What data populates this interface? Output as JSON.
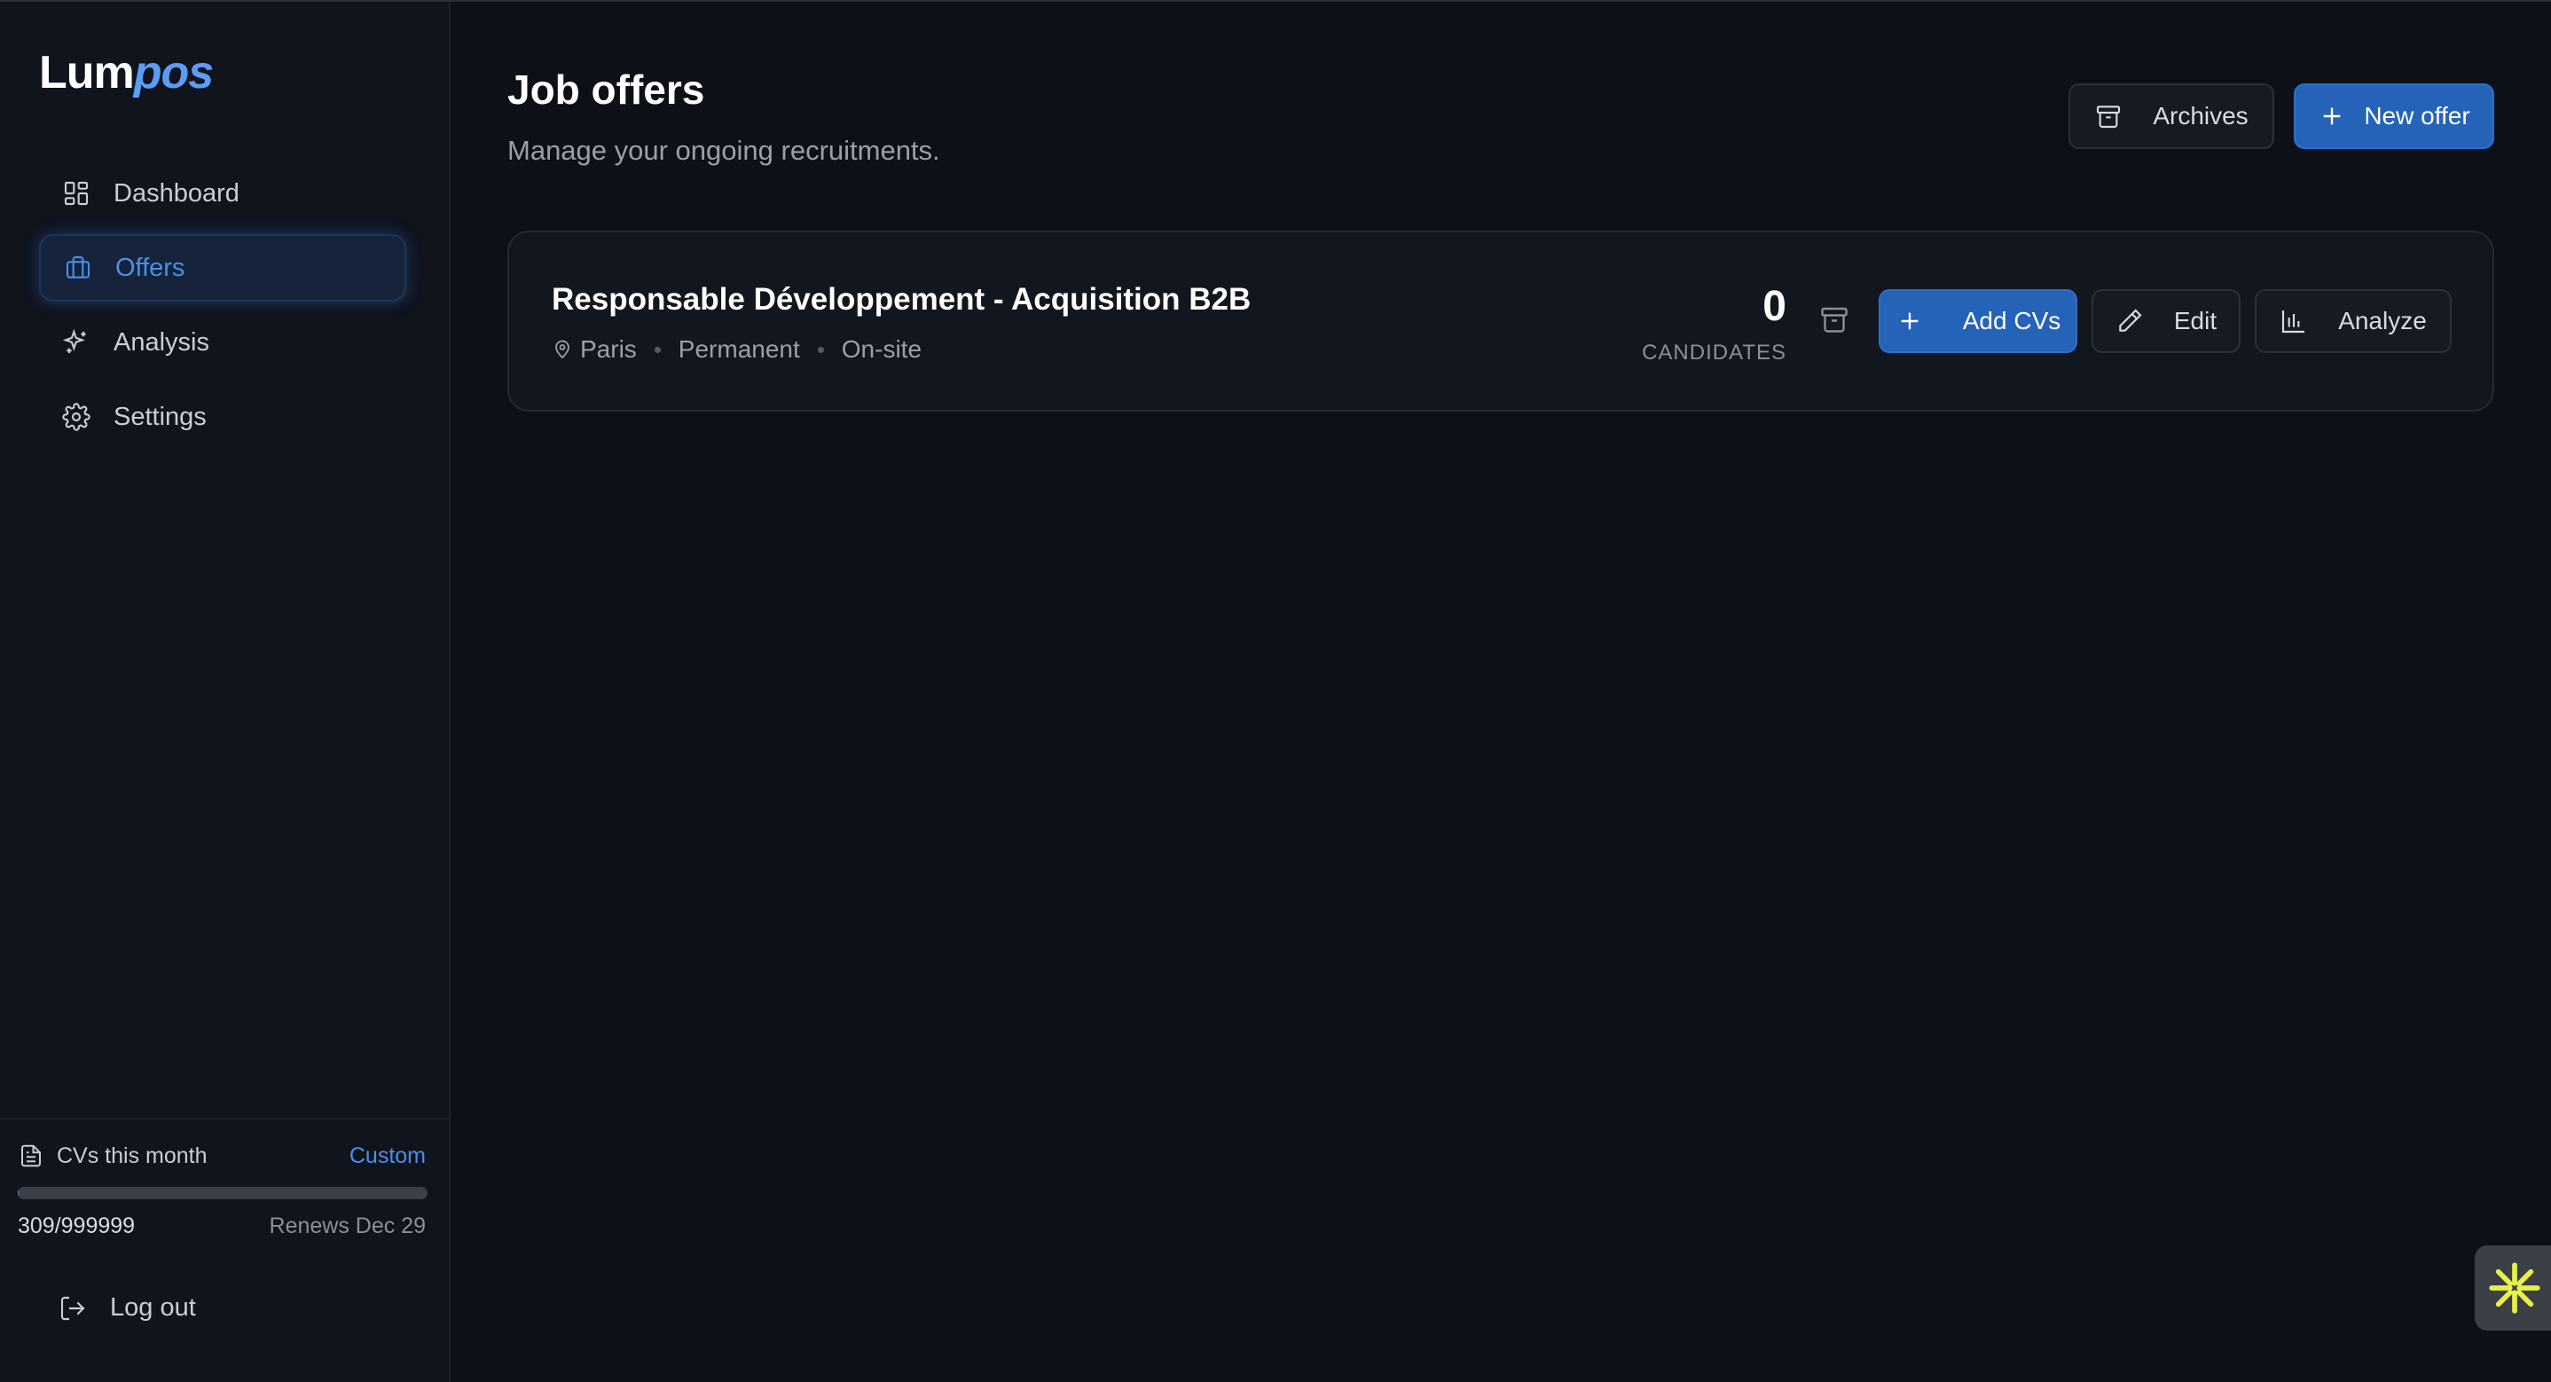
{
  "app": {
    "logo_part1": "Lum",
    "logo_part2": "pos"
  },
  "sidebar": {
    "items": [
      {
        "label": "Dashboard",
        "icon": "dashboard-icon",
        "active": false
      },
      {
        "label": "Offers",
        "icon": "briefcase-icon",
        "active": true
      },
      {
        "label": "Analysis",
        "icon": "sparkles-icon",
        "active": false
      },
      {
        "label": "Settings",
        "icon": "gear-icon",
        "active": false
      }
    ],
    "quota": {
      "label": "CVs this month",
      "plan": "Custom",
      "count": "309/999999",
      "renew": "Renews Dec 29",
      "progress_fraction": 0.0003
    },
    "logout_label": "Log out"
  },
  "main": {
    "title": "Job offers",
    "subtitle": "Manage your ongoing recruitments.",
    "archives_label": "Archives",
    "new_offer_label": "New offer",
    "offers": [
      {
        "title": "Responsable Développement - Acquisition B2B",
        "location": "Paris",
        "contract": "Permanent",
        "workplace": "On-site",
        "candidates_count": "0",
        "candidates_label": "CANDIDATES",
        "add_cvs_label": "Add CVs",
        "edit_label": "Edit",
        "analyze_label": "Analyze"
      }
    ]
  },
  "colors": {
    "accent": "#4a90e8",
    "primary_button": "#2563b8",
    "background": "#0d1016",
    "sidebar": "#0f141d",
    "widget_star": "#e8f04a"
  }
}
